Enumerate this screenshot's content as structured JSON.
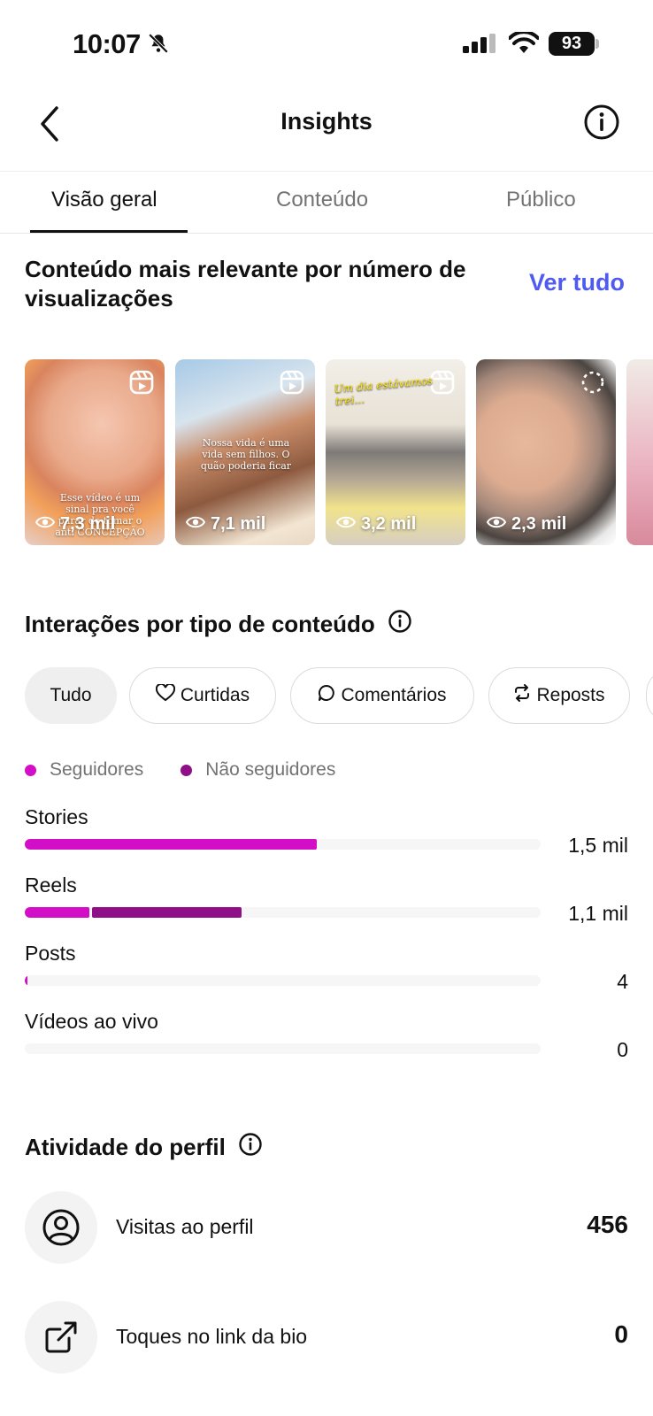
{
  "status_bar": {
    "time": "10:07",
    "battery": "93"
  },
  "header": {
    "title": "Insights"
  },
  "tabs": [
    {
      "label": "Visão geral",
      "active": true
    },
    {
      "label": "Conteúdo",
      "active": false
    },
    {
      "label": "Público",
      "active": false
    }
  ],
  "top_content": {
    "title": "Conteúdo mais relevante por número de visualizações",
    "see_all": "Ver tudo",
    "items": [
      {
        "views": "7,3 mil",
        "type": "reel",
        "caption": "Esse vídeo é um sinal pra você parar de tomar o anti CONCEPÇÃO"
      },
      {
        "views": "7,1 mil",
        "type": "reel",
        "caption": "Nossa vida é uma vida sem filhos. O quão poderia ficar"
      },
      {
        "views": "3,2 mil",
        "type": "reel",
        "caption": "Um dia estávamos trei..."
      },
      {
        "views": "2,3 mil",
        "type": "carousel",
        "caption": ""
      },
      {
        "views": "",
        "type": "reel",
        "caption": ""
      }
    ]
  },
  "interactions": {
    "title": "Interações por tipo de conteúdo",
    "filters": [
      "Tudo",
      "Curtidas",
      "Comentários",
      "Reposts"
    ],
    "legend": {
      "followers": "Seguidores",
      "non_followers": "Não seguidores"
    },
    "colors": {
      "followers": "#d20fc6",
      "non_followers": "#8e0f88"
    }
  },
  "chart_data": {
    "type": "bar",
    "orientation": "horizontal",
    "stacked": true,
    "categories": [
      "Stories",
      "Reels",
      "Posts",
      "Vídeos ao vivo"
    ],
    "totals_label": [
      "1,5 mil",
      "1,1 mil",
      "4",
      "0"
    ],
    "series": [
      {
        "name": "Seguidores",
        "values": [
          1500,
          330,
          4,
          0
        ]
      },
      {
        "name": "Não seguidores",
        "values": [
          0,
          770,
          0,
          0
        ]
      }
    ],
    "xlim": [
      0,
      2650
    ]
  },
  "profile_activity": {
    "title": "Atividade do perfil",
    "items": [
      {
        "label": "Visitas ao perfil",
        "value": "456",
        "icon": "user-circle-icon"
      },
      {
        "label": "Toques no link da bio",
        "value": "0",
        "icon": "external-link-icon"
      }
    ]
  }
}
